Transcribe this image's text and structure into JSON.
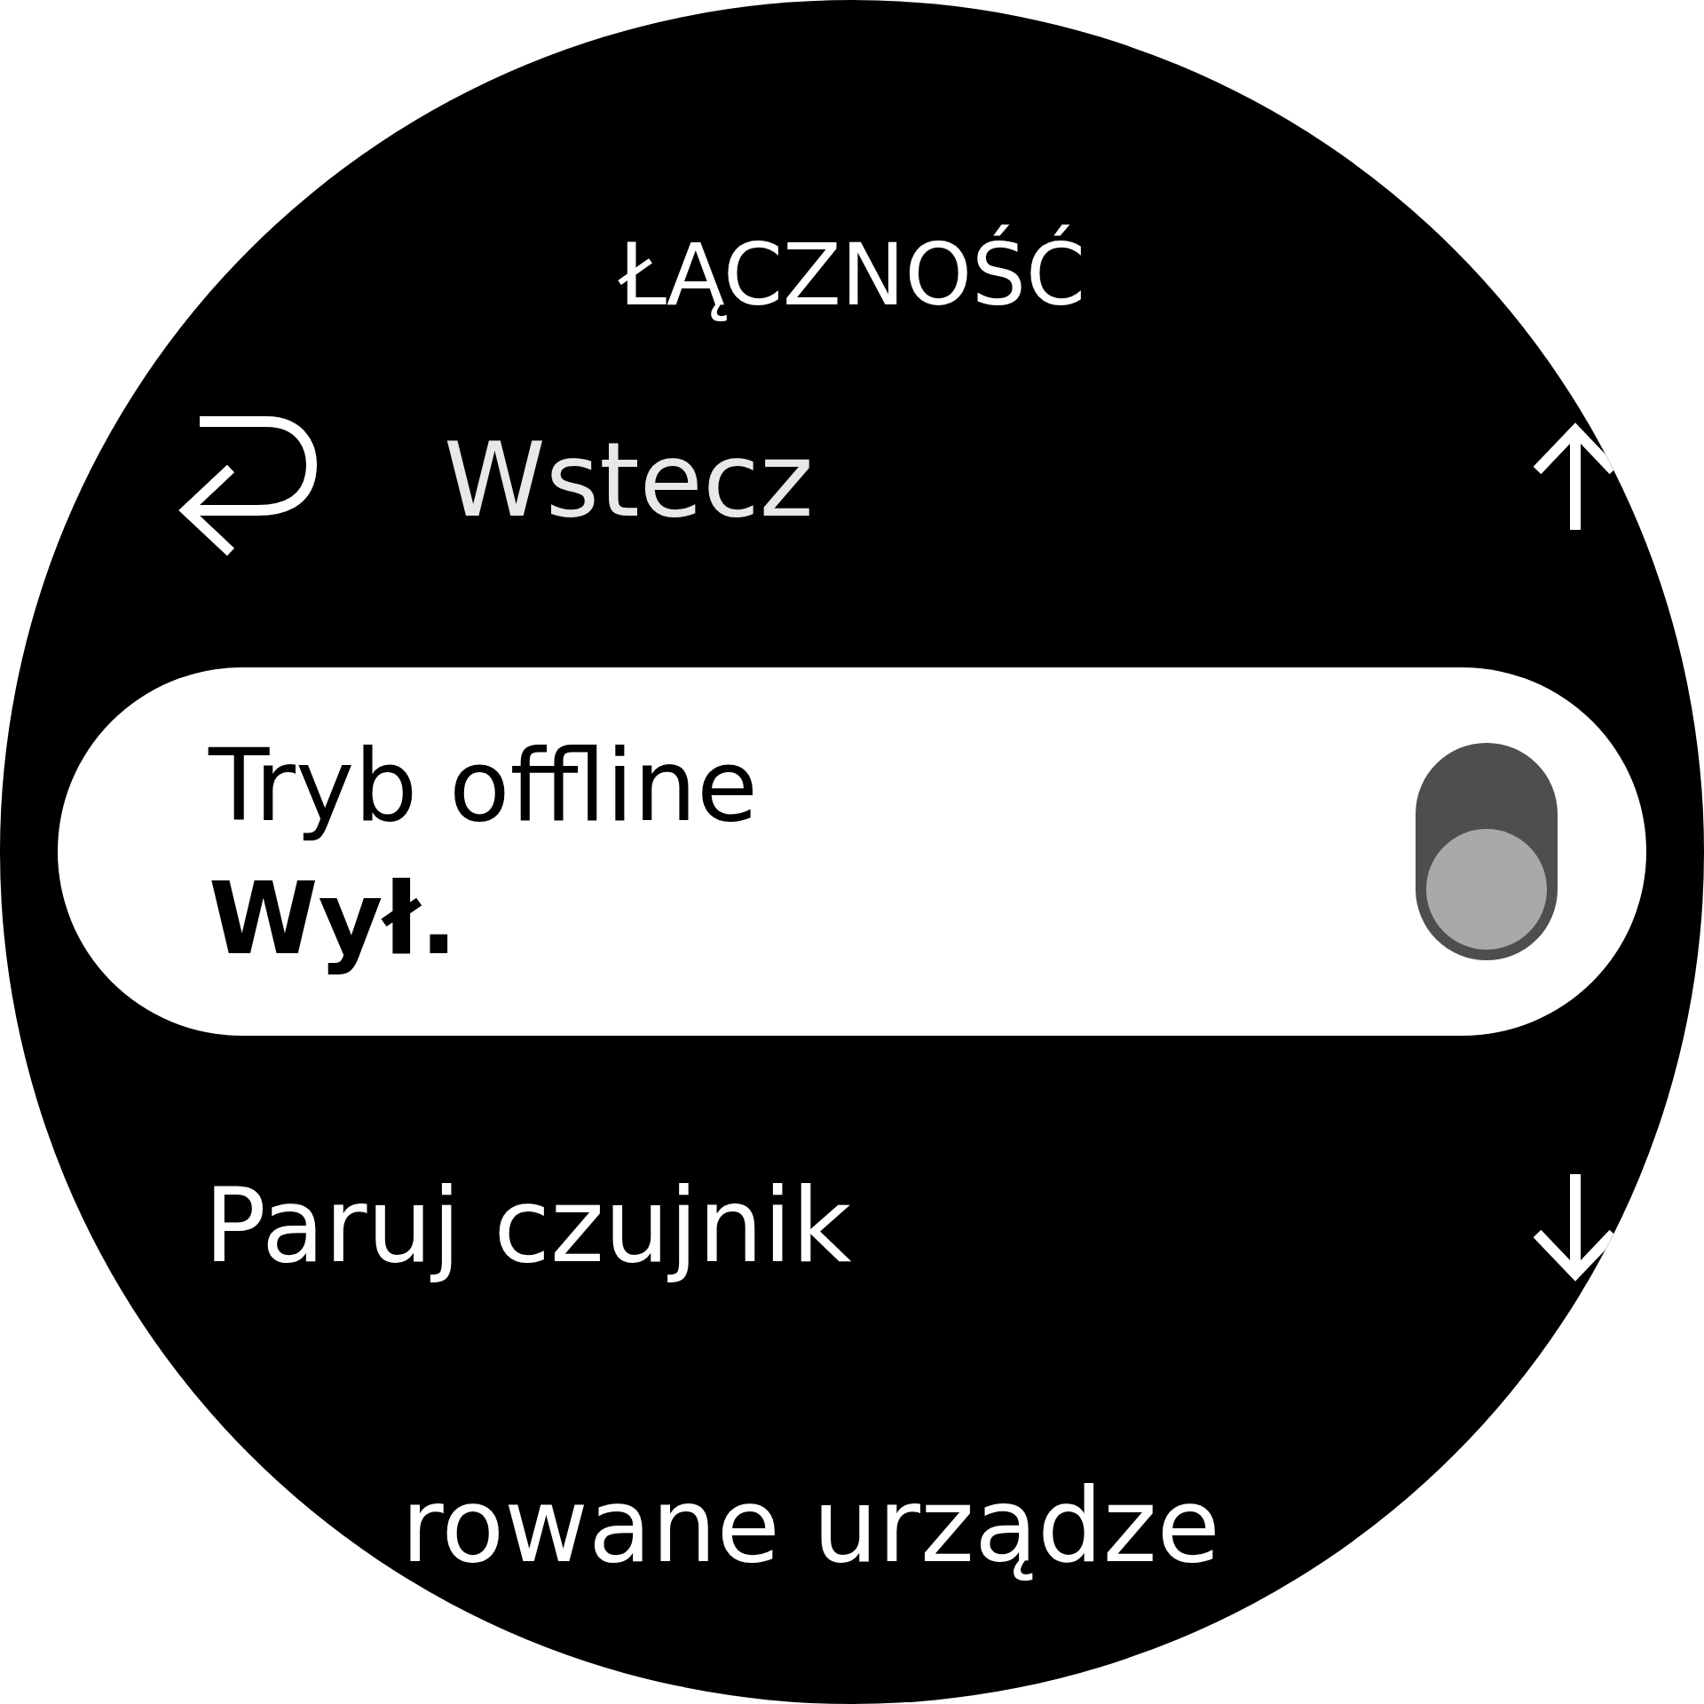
{
  "title": "ŁĄCZNOŚĆ",
  "back": {
    "label": "Wstecz"
  },
  "items": [
    {
      "kind": "toggle",
      "label": "Tryb offline",
      "value": "Wył.",
      "on": false,
      "selected": true
    },
    {
      "kind": "link",
      "label": "Paruj czujnik",
      "selected": false
    },
    {
      "kind": "link",
      "label": "rowane urządze",
      "selected": false
    }
  ]
}
